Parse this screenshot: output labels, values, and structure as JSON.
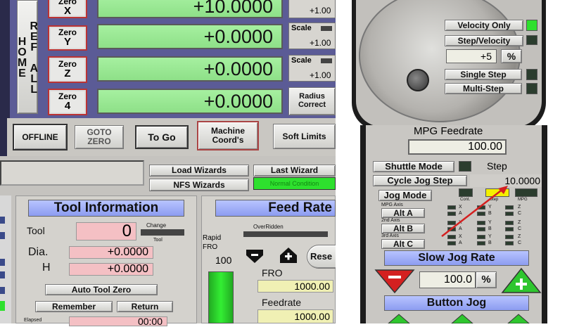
{
  "left": {
    "ref_all_home": "REF ALL HOME",
    "axes": [
      {
        "zero_top": "Zero",
        "axis": "X",
        "value": "+10.0000",
        "scale_label": "",
        "scale_value": "+1.00"
      },
      {
        "zero_top": "Zero",
        "axis": "Y",
        "value": "+0.0000",
        "scale_label": "Scale",
        "scale_value": "+1.00"
      },
      {
        "zero_top": "Zero",
        "axis": "Z",
        "value": "+0.0000",
        "scale_label": "Scale",
        "scale_value": "+1.00"
      },
      {
        "zero_top": "Zero",
        "axis": "4",
        "value": "+0.0000",
        "radius_label": "Radius Correct"
      }
    ],
    "buttons": {
      "offline": "OFFLINE",
      "goto_zero": "GOTO ZERO",
      "to_go": "To Go",
      "machine_coords": "Machine Coord's",
      "soft_limits": "Soft Limits"
    },
    "wizards": {
      "load": "Load Wizards",
      "last": "Last Wizard",
      "nfs": "NFS Wizards",
      "normal_condition": "Normal Condition"
    },
    "tool": {
      "title": "Tool Information",
      "tool_label": "Tool",
      "tool_value": "0",
      "change_label": "Change",
      "tool_small": "Tool",
      "dia_label": "Dia.",
      "dia_value": "+0.0000",
      "h_label": "H",
      "h_value": "+0.0000",
      "auto_tool_zero": "Auto Tool Zero",
      "remember": "Remember",
      "return": "Return",
      "elapsed_label": "Elapsed",
      "elapsed_value": "00:00"
    },
    "feed": {
      "title": "Feed Rate",
      "overridden": "OverRidden",
      "rapid_fro": "Rapid FRO",
      "rapid_value": "100",
      "reset": "Rese",
      "fro_label": "FRO",
      "fro_value": "1000.00",
      "feedrate_label": "Feedrate",
      "feedrate_value": "1000.00"
    }
  },
  "right": {
    "velocity_only": "Velocity Only",
    "step_velocity": "Step/Velocity",
    "percent_value": "+5",
    "percent_sign": "%",
    "single_step": "Single Step",
    "multi_step": "Multi-Step",
    "mpg_feedrate_label": "MPG Feedrate",
    "mpg_feedrate_value": "100.00",
    "shuttle_mode": "Shuttle Mode",
    "step_label": "Step",
    "cycle_jog_step": "Cycle Jog Step",
    "jog_step_value": "10.0000",
    "jog_mode": "Jog Mode",
    "col_cont": "Cont.",
    "col_step": "Step",
    "col_mpg": "MPG",
    "mpg_axis_label": "MPG Axis",
    "axis2_label": "2nd Axis",
    "axis3_label": "3rd Axis",
    "alt_a": "Alt A",
    "alt_b": "Alt B",
    "alt_c": "Alt C",
    "axis_letters_x": "X",
    "axis_letters_a": "A",
    "axis_letters_y": "Y",
    "axis_letters_b": "B",
    "axis_letters_z": "Z",
    "axis_letters_c": "C",
    "slow_jog_rate": "Slow Jog Rate",
    "jog_rate_value": "100.0",
    "jog_rate_pct": "%",
    "button_jog": "Button Jog",
    "minus": "-",
    "plus": "+"
  },
  "colors": {
    "accent_green": "#2ee02e",
    "dro_green": "#99e693",
    "title_blue": "#9aa8f4",
    "arrow_red": "#d42020"
  }
}
